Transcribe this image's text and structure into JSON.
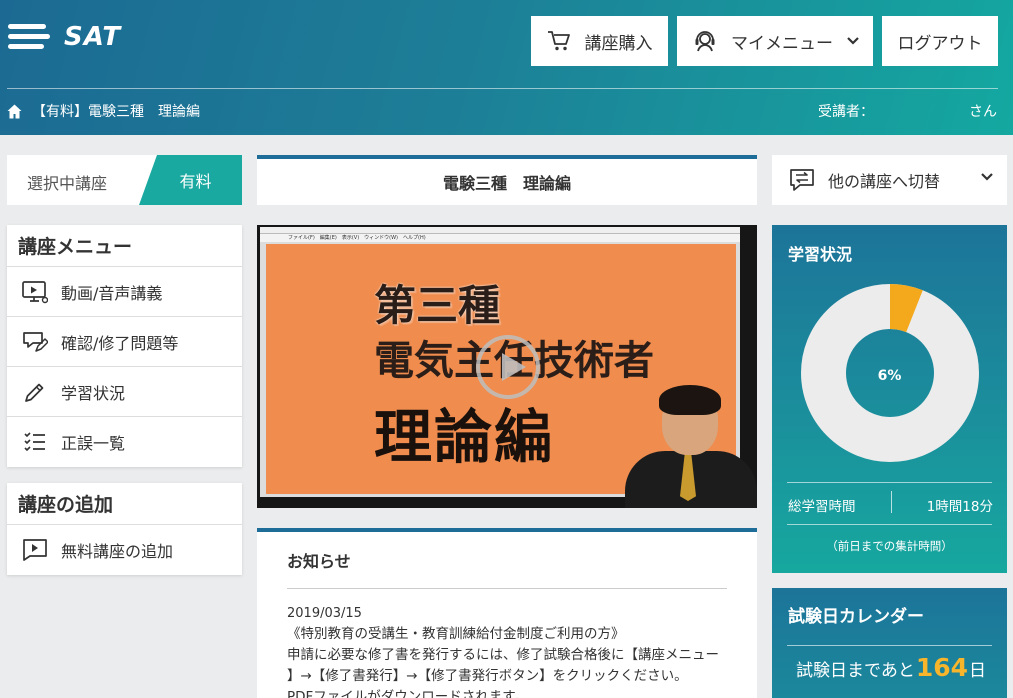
{
  "brand": {
    "name": "SAT"
  },
  "header": {
    "buy_label": "講座購入",
    "mymenu_label": "マイメニュー",
    "logout_label": "ログアウト"
  },
  "breadcrumb": {
    "text": "【有料】電験三種　理論編"
  },
  "student": {
    "label": "受講者：",
    "suffix": "さん"
  },
  "selected_course": {
    "label": "選択中講座",
    "tag": "有料"
  },
  "course_menu": {
    "title": "講座メニュー",
    "items": [
      {
        "label": "動画/音声講義",
        "icon": "video-lecture-icon"
      },
      {
        "label": "確認/修了問題等",
        "icon": "quiz-edit-icon"
      },
      {
        "label": "学習状況",
        "icon": "pencil-icon"
      },
      {
        "label": "正誤一覧",
        "icon": "checklist-icon"
      }
    ]
  },
  "add_course": {
    "title": "講座の追加",
    "items": [
      {
        "label": "無料講座の追加",
        "icon": "play-chat-icon"
      }
    ]
  },
  "course_header": {
    "title": "電験三種　理論編"
  },
  "video": {
    "app_menu": "ファイル(F)　編集(E)　表示(V)　ウィンドウ(W)　ヘルプ(H)",
    "slide_line1": "第三種",
    "slide_line2": "電気主任技術者",
    "slide_line3": "理論編"
  },
  "news": {
    "title": "お知らせ",
    "date": "2019/03/15",
    "lines": [
      "《特別教育の受講生・教育訓練給付金制度ご利用の方》",
      "申請に必要な修了書を発行するには、修了試験合格後に【講座メニュー",
      "】→【修了書発行】→【修了書発行ボタン】をクリックください。",
      "PDFファイルがダウンロードされます。"
    ]
  },
  "switch_course": {
    "label": "他の講座へ切替"
  },
  "study_status": {
    "title": "学習状況",
    "progress_percent": 6,
    "progress_label": "6%",
    "total_time_label": "総学習時間",
    "total_time_value": "1時間18分",
    "note": "（前日までの集計時間）"
  },
  "exam_calendar": {
    "title": "試験日カレンダー",
    "prefix": "試験日まであと",
    "days": "164",
    "suffix": "日"
  },
  "colors": {
    "header_start": "#1c6a93",
    "header_end": "#14a8a0",
    "teal": "#1aa9a0",
    "progress": "#f4a81c",
    "donut_track": "#ececec"
  }
}
